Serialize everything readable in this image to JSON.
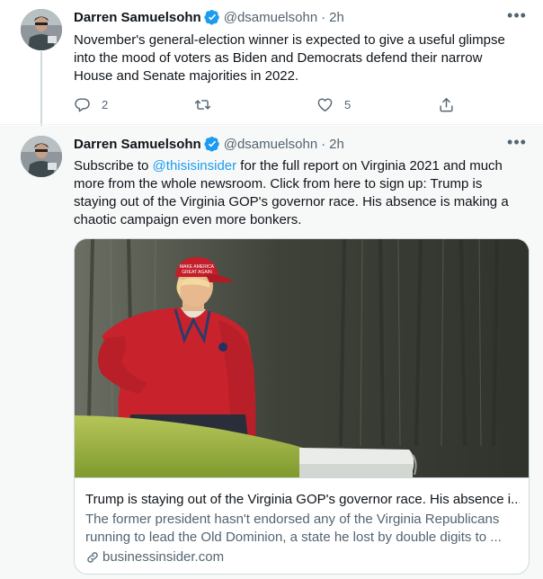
{
  "tweets": [
    {
      "author_name": "Darren Samuelsohn",
      "handle": "@dsamuelsohn",
      "separator": "·",
      "time": "2h",
      "text": "November's general-election winner is expected to give a useful glimpse into the mood of voters as Biden and Democrats defend their narrow House and Senate majorities in 2022.",
      "reply_count": "2",
      "retweet_count": "",
      "like_count": "5",
      "more_label": "•••"
    },
    {
      "author_name": "Darren Samuelsohn",
      "handle": "@dsamuelsohn",
      "separator": "·",
      "time": "2h",
      "text_before": "Subscribe to ",
      "mention": "@thisisinsider",
      "text_after": " for the full report on Virginia 2021 and much more from the whole newsroom. Click from here to sign up: Trump is staying out of the Virginia GOP's governor race. His absence is making a chaotic campaign even more bonkers.",
      "more_label": "•••",
      "card": {
        "image_hat_text": "MAKE AMERICA GREAT AGAIN",
        "title": "Trump is staying out of the Virginia GOP's governor race. His absence i...",
        "description": "The former president hasn't endorsed any of the Virginia Republicans running to lead the Old Dominion, a state he lost by double digits to ...",
        "domain": "businessinsider.com"
      }
    }
  ],
  "icons": {
    "verified": "verified-badge-icon",
    "more": "more-icon",
    "reply": "reply-icon",
    "retweet": "retweet-icon",
    "like": "like-icon",
    "share": "share-icon",
    "link": "link-icon"
  },
  "colors": {
    "accent": "#1d9bf0",
    "secondary_text": "#536471",
    "selected_background": "#f7f9f9",
    "border": "#cfd9de"
  }
}
